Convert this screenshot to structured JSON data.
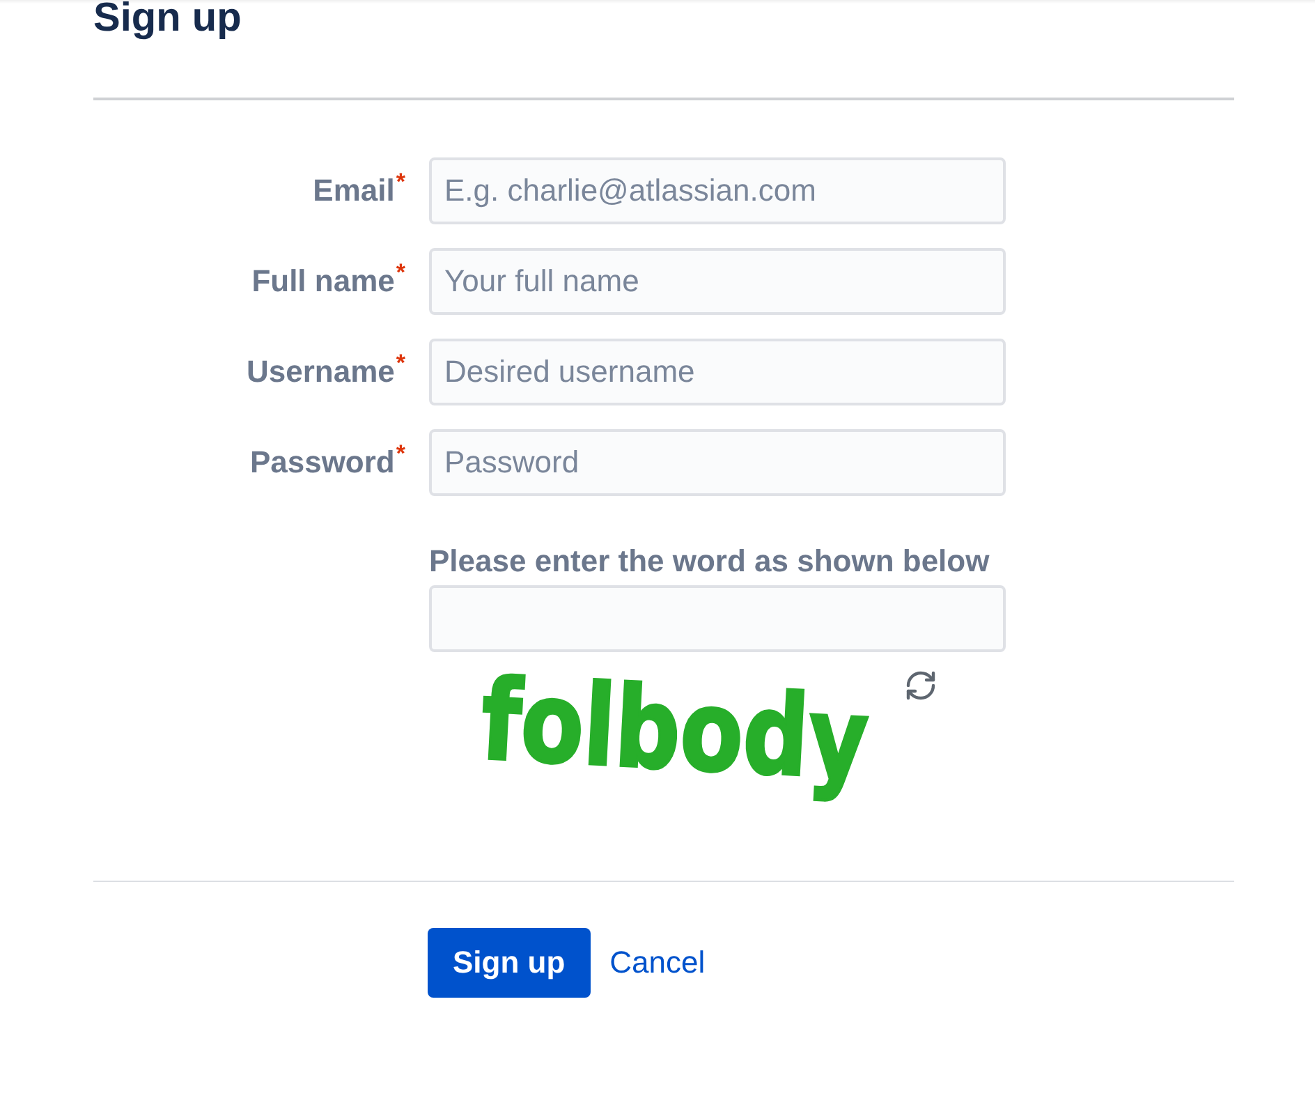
{
  "title": "Sign up",
  "fields": [
    {
      "label": "Email",
      "required_mark": "*",
      "placeholder": "E.g. charlie@atlassian.com"
    },
    {
      "label": "Full name",
      "required_mark": "*",
      "placeholder": "Your full name"
    },
    {
      "label": "Username",
      "required_mark": "*",
      "placeholder": "Desired username"
    },
    {
      "label": "Password",
      "required_mark": "*",
      "placeholder": "Password"
    }
  ],
  "captcha": {
    "label": "Please enter the word as shown below",
    "word": "folbody"
  },
  "actions": {
    "submit": "Sign up",
    "cancel": "Cancel"
  }
}
